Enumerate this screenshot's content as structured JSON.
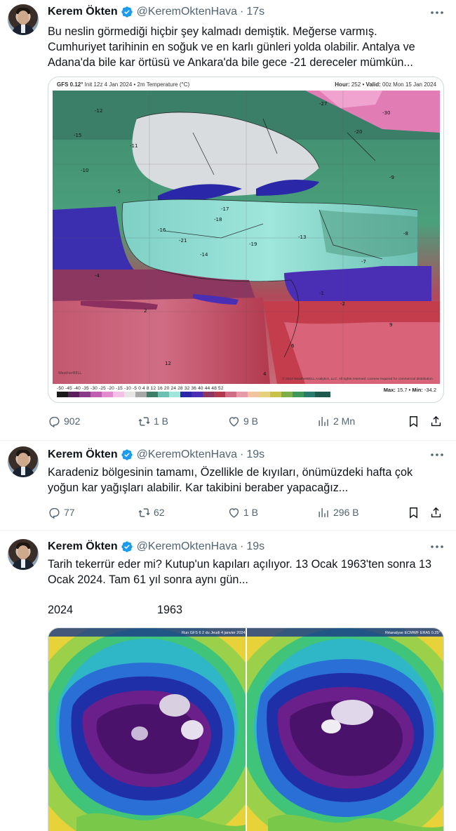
{
  "accent_color": "#1d9bf0",
  "tweets": [
    {
      "author_name": "Kerem Ökten",
      "handle": "@KeremOktenHava",
      "separator": "·",
      "time": "17s",
      "text_lines": [
        "Bu neslin görmediği hiçbir şey kalmadı demiştik. Meğerse varmış.",
        "Cumhuriyet tarihinin en soğuk ve en karlı günleri yolda olabilir. Antalya ve",
        "Adana'da bile kar örtüsü ve Ankara'da bile gece -21 dereceler mümkün..."
      ],
      "map": {
        "title_bold": "GFS 0.12°",
        "title_rest": " Init 12z 4 Jan 2024 • 2m Temperature (°C)",
        "hour_label": "Hour:",
        "hour_value": "252",
        "valid_label": "• Valid:",
        "valid_value": "00z Mon 15 Jan 2024",
        "scale_ticks": "-50  -45  -40  -35  -30  -25  -20  -15  -10   -5    0    4    8   12   16   20   24   28   32   36   40   44   48   52",
        "max_label": "Max:",
        "max_value": "15.7",
        "min_label": "• Min:",
        "min_value": "-34.2",
        "credit": "© 2024 WeatherBELL Analytics, LLC. All rights reserved. License required for commercial distribution.",
        "watermark": "WeatherBELL",
        "temp_labels": [
          "-15",
          "-20",
          "-21",
          "-17",
          "-16",
          "-14",
          "-19",
          "-10",
          "-12",
          "-9",
          "-13",
          "-8",
          "-18",
          "-11",
          "-7",
          "-4",
          "-1",
          "2",
          "6",
          "9",
          "12",
          "4",
          "-2",
          "-5",
          "-27",
          "-30"
        ]
      },
      "replies": "902",
      "retweets": "1 B",
      "likes": "9 B",
      "views": "2 Mn"
    },
    {
      "author_name": "Kerem Ökten",
      "handle": "@KeremOktenHava",
      "separator": "·",
      "time": "19s",
      "text_lines": [
        "Karadeniz bölgesinin tamamı, Özellikle de kıyıları, önümüzdeki hafta çok",
        "yoğun kar yağışları alabilir. Kar takibini beraber yapacağız..."
      ],
      "replies": "77",
      "retweets": "62",
      "likes": "1 B",
      "views": "296 B"
    },
    {
      "author_name": "Kerem Ökten",
      "handle": "@KeremOktenHava",
      "separator": "·",
      "time": "19s",
      "text_lines": [
        "Tarih tekerrür eder mi? Kutup'un kapıları açılıyor. 13 Ocak 1963'ten sonra 13",
        "Ocak 2024. Tam 61 yıl sonra aynı gün..."
      ],
      "year_left": "2024",
      "year_right": "1963",
      "left_map_title": "Run GFS 6 2 du Jeudi 4 janvier 2024",
      "right_map_title": "Réanalyse ECMWF ERA5 0.25°"
    }
  ]
}
